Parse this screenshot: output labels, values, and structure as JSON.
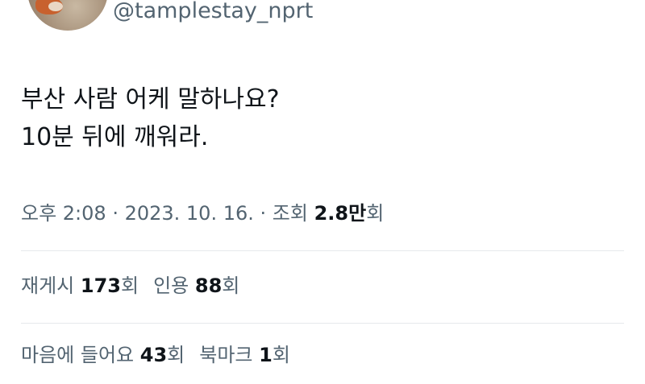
{
  "author": {
    "handle": "@tamplestay_nprt"
  },
  "tweet": {
    "lines": [
      "부산 사람 어케 말하나요?",
      "10분 뒤에 깨워라."
    ]
  },
  "meta": {
    "time": "오후 2:08",
    "sep1": " · ",
    "date": "2023. 10. 16.",
    "sep2": " · ",
    "views_prefix": "조회 ",
    "views_value": "2.8만",
    "views_suffix": "회"
  },
  "stats_row1": {
    "reposts_label": "재게시 ",
    "reposts_value": "173",
    "reposts_suffix": "회",
    "quotes_label": "인용 ",
    "quotes_value": "88",
    "quotes_suffix": "회"
  },
  "stats_row2": {
    "likes_label": "마음에 들어요 ",
    "likes_value": "43",
    "likes_suffix": "회",
    "bookmarks_label": "북마크 ",
    "bookmarks_value": "1",
    "bookmarks_suffix": "회"
  }
}
